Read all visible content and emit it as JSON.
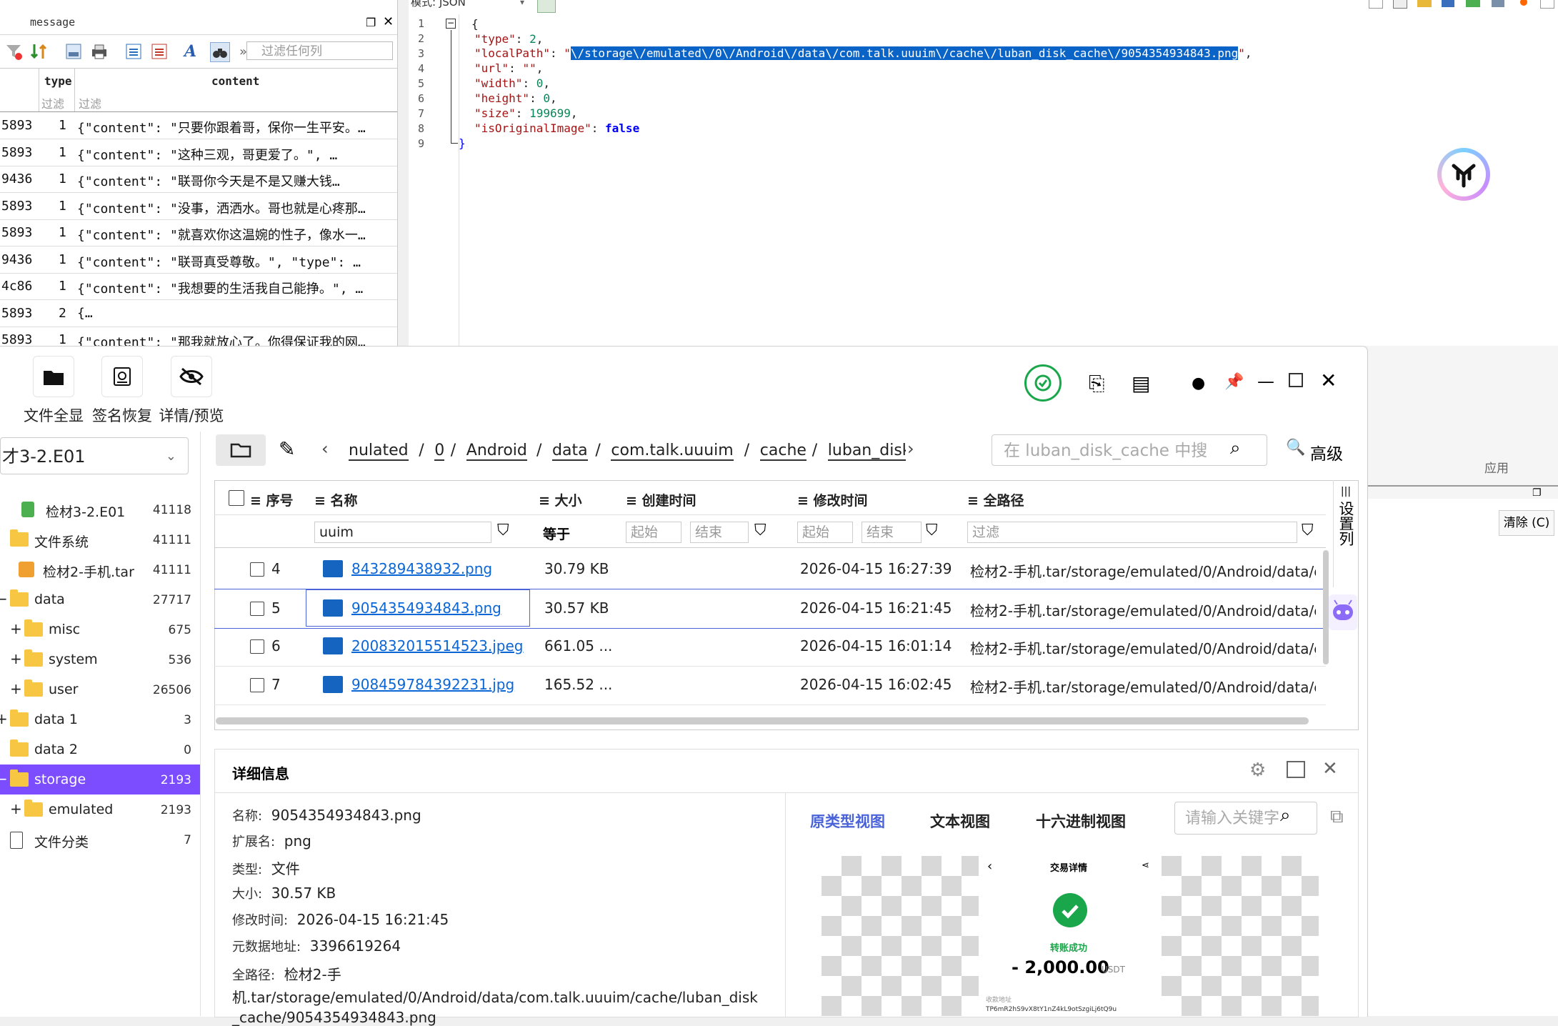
{
  "message_panel": {
    "title": "message",
    "filter_placeholder": "过滤任何列",
    "columns": {
      "type": "type",
      "content": "content"
    },
    "column_filters": {
      "type": "过滤",
      "content": "过滤"
    },
    "rows": [
      {
        "id": "5893",
        "type": "1",
        "content": "{\"content\": \"只要你跟着哥，保你一生平安。…"
      },
      {
        "id": "5893",
        "type": "1",
        "content": "{\"content\": \"这种三观，哥更爱了。\", …"
      },
      {
        "id": "9436",
        "type": "1",
        "content": "{\"content\": \"联哥你今天是不是又赚大钱…"
      },
      {
        "id": "5893",
        "type": "1",
        "content": "{\"content\": \"没事，洒洒水。哥也就是心疼那…"
      },
      {
        "id": "5893",
        "type": "1",
        "content": "{\"content\": \"就喜欢你这温婉的性子，像水一…"
      },
      {
        "id": "9436",
        "type": "1",
        "content": "{\"content\": \"联哥真受尊敬。\", \"type\": …"
      },
      {
        "id": "4c86",
        "type": "1",
        "content": "{\"content\": \"我想要的生活我自己能挣。\", …"
      },
      {
        "id": "5893",
        "type": "2",
        "content": "{…"
      },
      {
        "id": "5893",
        "type": "1",
        "content": "{\"content\": \"那我就放心了。你得保证我的网…"
      }
    ]
  },
  "json_editor": {
    "mode_label": "模式: JSON",
    "line_numbers": [
      "1",
      "2",
      "3",
      "4",
      "5",
      "6",
      "7",
      "8",
      "9"
    ],
    "lines": {
      "l1": "{",
      "type_key": "\"type\"",
      "type_val": "2",
      "localPath_key": "\"localPath\"",
      "localPath_val": "\\/storage\\/emulated\\/0\\/Android\\/data\\/com.talk.uuuim\\/cache\\/luban_disk_cache\\/9054354934843.png",
      "url_key": "\"url\"",
      "url_val": "\"\"",
      "width_key": "\"width\"",
      "width_val": "0",
      "height_key": "\"height\"",
      "height_val": "0",
      "size_key": "\"size\"",
      "size_val": "199699",
      "isOriginal_key": "\"isOriginalImage\"",
      "isOriginal_val": "false",
      "l9": "}"
    }
  },
  "explorer": {
    "toolbar": [
      {
        "label": "文件全显",
        "icon": "folder-icon"
      },
      {
        "label": "签名恢复",
        "icon": "signature-icon"
      },
      {
        "label": "详情/预览",
        "icon": "eye-off-icon"
      }
    ],
    "case_select": "才3-2.E01",
    "tree": [
      {
        "label": "检材3-2.E01",
        "count": "41118",
        "expander": ""
      },
      {
        "label": "文件系统",
        "count": "41111",
        "expander": ""
      },
      {
        "label": "检材2-手机.tar",
        "count": "41111",
        "expander": ""
      },
      {
        "label": "data",
        "count": "27717",
        "expander": "−"
      },
      {
        "label": "misc",
        "count": "675",
        "expander": "+"
      },
      {
        "label": "system",
        "count": "536",
        "expander": "+"
      },
      {
        "label": "user",
        "count": "26506",
        "expander": "+"
      },
      {
        "label": "data 1",
        "count": "3",
        "expander": "+"
      },
      {
        "label": "data 2",
        "count": "0",
        "expander": ""
      },
      {
        "label": "storage",
        "count": "2193",
        "expander": "−"
      },
      {
        "label": "emulated",
        "count": "2193",
        "expander": "+"
      },
      {
        "label": "文件分类",
        "count": "7",
        "expander": ""
      }
    ],
    "breadcrumb": [
      "nulated",
      "0",
      "Android",
      "data",
      "com.talk.uuuim",
      "cache",
      "luban_disk_cache"
    ],
    "search_placeholder": "在 luban_disk_cache 中搜",
    "advanced_label": "高级",
    "columns": [
      "序号",
      "名称",
      "大小",
      "创建时间",
      "修改时间",
      "全路径"
    ],
    "filters": {
      "name": "uuim",
      "size": "等于",
      "start": "起始",
      "end": "结束",
      "start2": "起始",
      "end2": "结束",
      "path": "过滤"
    },
    "settings_col": "设置列",
    "rows": [
      {
        "no": "4",
        "name": "843289438932.png",
        "size": "30.79 KB",
        "created": "",
        "modified": "2026-04-15 16:27:39",
        "path": "检材2-手机.tar/storage/emulated/0/Android/data/c..."
      },
      {
        "no": "5",
        "name": "9054354934843.png",
        "size": "30.57 KB",
        "created": "",
        "modified": "2026-04-15 16:21:45",
        "path": "检材2-手机.tar/storage/emulated/0/Android/data/c..."
      },
      {
        "no": "6",
        "name": "200832015514523.jpeg",
        "size": "661.05 ...",
        "created": "",
        "modified": "2026-04-15 16:01:14",
        "path": "检材2-手机.tar/storage/emulated/0/Android/data/c..."
      },
      {
        "no": "7",
        "name": "908459784392231.jpg",
        "size": "165.52 ...",
        "created": "",
        "modified": "2026-04-15 16:02:45",
        "path": "检材2-手机.tar/storage/emulated/0/Android/data/c..."
      }
    ],
    "details": {
      "title": "详细信息",
      "name_label": "名称:",
      "name": "9054354934843.png",
      "ext_label": "扩展名:",
      "ext": "png",
      "type_label": "类型:",
      "type": "文件",
      "size_label": "大小:",
      "size": "30.57 KB",
      "mtime_label": "修改时间:",
      "mtime": "2026-04-15 16:21:45",
      "meta_label": "元数据地址:",
      "meta": "3396619264",
      "path_label": "全路径:",
      "path1": "检材2-手",
      "path2": "机.tar/storage/emulated/0/Android/data/com.talk.uuuim/cache/luban_disk",
      "path3": "_cache/9054354934843.png"
    },
    "preview_tabs": [
      "原类型视图",
      "文本视图",
      "十六进制视图"
    ],
    "preview_search_placeholder": "请输入关键字",
    "preview_image": {
      "title": "交易详情",
      "status": "转账成功",
      "amount": "- 2,000.00",
      "unit": "USDT",
      "addr_label": "收款地址",
      "addr": "TP6mR2hS9vX8tY1nZ4kL9otSzgiLj6tQ9u"
    }
  },
  "side_panel": {
    "apply": "应用",
    "clear": "清除 (C)"
  },
  "colors": {
    "accent": "#0b66d6",
    "selected_tree": "#7c4dff",
    "json_selection": "#0a64c8",
    "success": "#1aa64a"
  }
}
